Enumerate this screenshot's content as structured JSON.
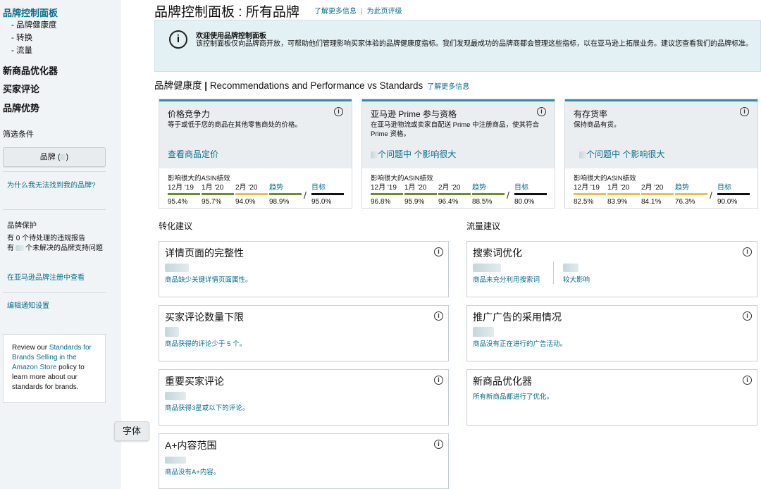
{
  "sidebar": {
    "main_item": "品牌控制面板",
    "sub_items": [
      "- 品牌健康度",
      "- 转换",
      "- 流量"
    ],
    "nav_items": [
      "新商品优化器",
      "买家评论",
      "品牌优势"
    ],
    "filter_label": "筛选条件",
    "filter_button": "品牌 (",
    "filter_button_end": ")",
    "why_link": "为什么我无法找到我的品牌?",
    "protection_title": "品牌保护",
    "violations_text": "有 0 个待处理的违规报告",
    "support_prefix": "有",
    "support_suffix": "个未解决的品牌支持问题",
    "registry_link": "在亚马逊品牌注册中查看",
    "notify_link": "编辑通知设置",
    "info_pre": "Review our ",
    "info_link": "Standards for Brands Selling in the Amazon Store",
    "info_post": " policy to learn more about our standards for brands."
  },
  "tooltip": "字体",
  "header": {
    "title": "品牌控制面板 : 所有品牌",
    "learn_more": "了解更多信息",
    "rate_page": "为此页评级"
  },
  "banner": {
    "title": "欢迎使用品牌控制面板",
    "text": "该控制面板仅向品牌商开放，可帮助他们管理影响买家体验的品牌健康度指标。我们发现最成功的品牌商都会管理这些指标，以在亚马逊上拓展业务。建议您查看我们的品牌标准。"
  },
  "health": {
    "title": "品牌健康度",
    "subtitle": "Recommendations and Performance vs Standards",
    "learn_more": "了解更多信息",
    "perf_label": "影响很大的ASIN绩效",
    "headers": [
      "12月 '19",
      "1月 '20",
      "2月 '20",
      "趋势",
      "目标"
    ],
    "cards": [
      {
        "title": "价格竞争力",
        "desc": "等于或低于您的商品在其他零售商处的价格。",
        "link": "查看商品定价",
        "values": [
          "95.4%",
          "95.7%",
          "94.0%",
          "98.9%",
          "95.0%"
        ]
      },
      {
        "title": "亚马逊 Prime 参与资格",
        "desc": "在亚马逊物流或卖家自配送 Prime 中注册商品，使其符合 Prime 资格。",
        "link": "个问题中 个影响很大",
        "values": [
          "96.8%",
          "95.9%",
          "96.4%",
          "88.5%",
          "80.0%"
        ]
      },
      {
        "title": "有存货率",
        "desc": "保持商品有货。",
        "link": "个问题中 个影响很大",
        "values": [
          "82.5%",
          "83.9%",
          "84.1%",
          "76.3%",
          "90.0%"
        ]
      }
    ]
  },
  "conversion": {
    "heading": "转化建议",
    "cards": [
      {
        "title": "详情页面的完整性",
        "desc": "商品缺少关键详情页面属性。"
      },
      {
        "title": "买家评论数量下限",
        "desc": "商品获得的评论少于 5 个。"
      },
      {
        "title": "重要买家评论",
        "desc": "商品获得3星或以下的评论。"
      },
      {
        "title": "A+内容范围",
        "desc": "商品没有A+内容。"
      }
    ]
  },
  "traffic": {
    "heading": "流量建议",
    "cards": [
      {
        "title": "搜索词优化",
        "desc": "商品未充分利用搜索词",
        "desc2": "较大影响"
      },
      {
        "title": "推广广告的采用情况",
        "desc": "商品没有正在进行的广告活动。"
      },
      {
        "title": "新商品优化器",
        "desc": "所有新商品都进行了优化。"
      }
    ]
  },
  "colors": {
    "accent": "#0a6e8a",
    "bar_green": "#6b8e23",
    "bar_yellow": "#e8c14a",
    "bar_target": "#111111",
    "banner_bg": "#e3f0f4"
  }
}
